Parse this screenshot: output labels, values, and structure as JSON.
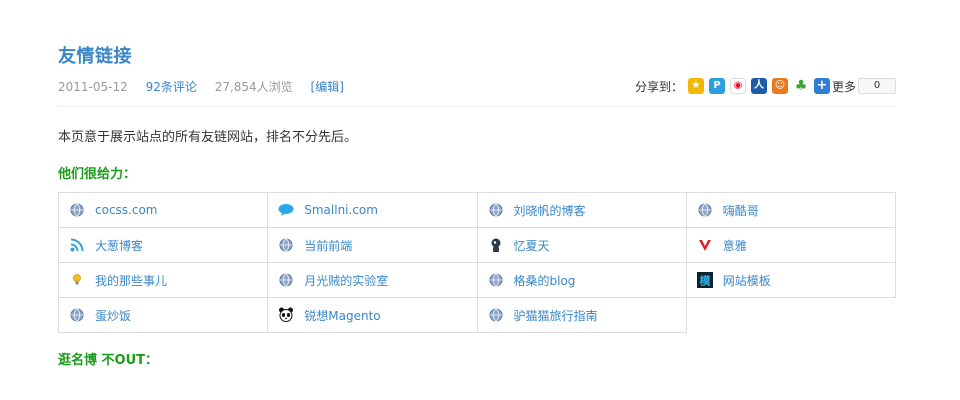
{
  "post": {
    "title": "友情链接",
    "date": "2011-05-12",
    "comments": "92条评论",
    "views": "27,854人浏览",
    "edit": "[编辑]"
  },
  "share": {
    "label": "分享到：",
    "icons": [
      "qzone-icon",
      "pengyou-icon",
      "weibo-icon",
      "renren-icon",
      "kaixin-icon",
      "clover-icon",
      "plus-icon"
    ],
    "more": "更多",
    "count": "0"
  },
  "intro": "本页意于展示站点的所有友链网站，排名不分先后。",
  "sections": {
    "giving": "他们很给力：",
    "anonymous": "逛名博 不OUT："
  },
  "links": [
    [
      {
        "label": "cocss.com",
        "icon": "globe-icon"
      },
      {
        "label": "Smallni.com",
        "icon": "speech-bubble-icon"
      },
      {
        "label": "刘晓帆的博客",
        "icon": "globe-icon"
      },
      {
        "label": "嗨酷哥",
        "icon": "globe-icon"
      }
    ],
    [
      {
        "label": "大葱博客",
        "icon": "rss-icon"
      },
      {
        "label": "当前前端",
        "icon": "globe-icon"
      },
      {
        "label": "忆夏天",
        "icon": "person-icon"
      },
      {
        "label": "意雅",
        "icon": "logo-y-icon"
      }
    ],
    [
      {
        "label": "我的那些事儿",
        "icon": "bulb-icon"
      },
      {
        "label": "月光贼的实验室",
        "icon": "globe-icon"
      },
      {
        "label": "格桑的blog",
        "icon": "globe-icon"
      },
      {
        "label": "网站模板",
        "icon": "mo-icon"
      }
    ],
    [
      {
        "label": "蛋炒饭",
        "icon": "globe-icon"
      },
      {
        "label": "锐想Magento",
        "icon": "panda-icon"
      },
      {
        "label": "驴猫猫旅行指南",
        "icon": "globe-icon"
      }
    ]
  ],
  "colors": {
    "link": "#3a87c8",
    "section": "#1a9b1a",
    "border": "#dcdcdc"
  }
}
